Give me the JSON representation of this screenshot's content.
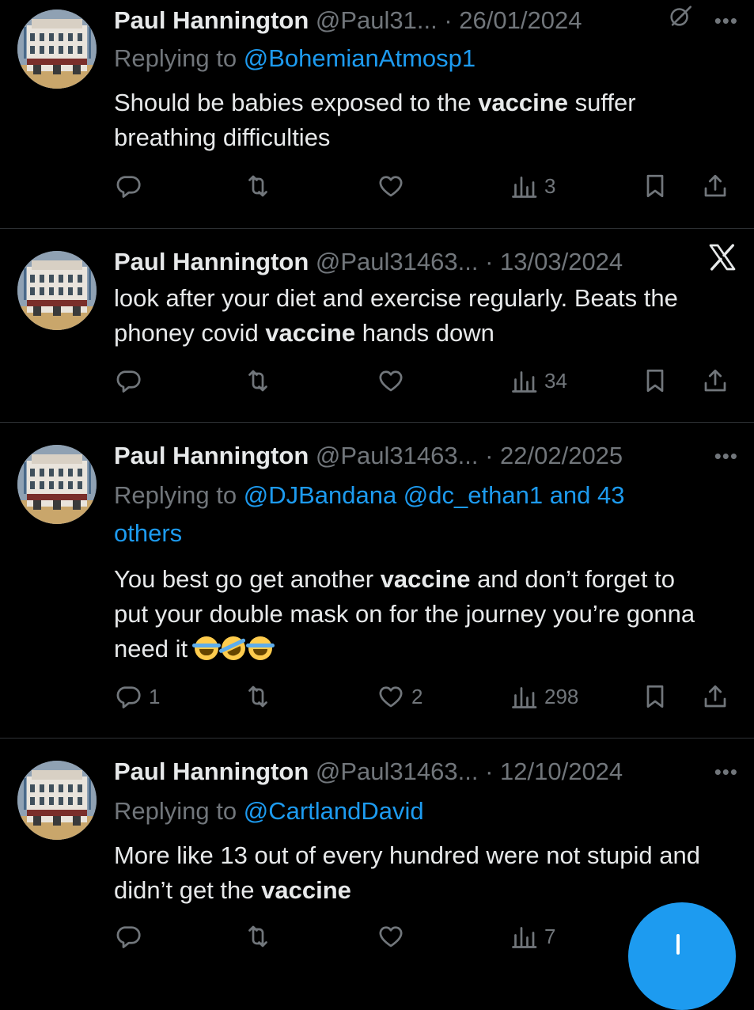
{
  "author": {
    "name": "Paul Hannington"
  },
  "tweets": [
    {
      "handle": "@Paul31...",
      "date": "26/01/2024",
      "reply_prefix": "Replying to",
      "reply_to": "@BohemianAtmosp1",
      "text_parts": [
        "Should be babies exposed to the ",
        "vaccine",
        " suffer breathing difficulties"
      ],
      "metrics": {
        "replies": "",
        "reposts": "",
        "likes": "",
        "views": "3"
      }
    },
    {
      "handle": "@Paul31463...",
      "date": "13/03/2024",
      "text_parts": [
        "look after your diet and exercise regularly. Beats the phoney covid ",
        "vaccine",
        " hands down"
      ],
      "metrics": {
        "replies": "",
        "reposts": "",
        "likes": "",
        "views": "34"
      }
    },
    {
      "handle": "@Paul31463...",
      "date": "22/02/2025",
      "reply_prefix": "Replying to",
      "reply_to": "@DJBandana @dc_ethan1 and 43 others",
      "text_parts": [
        "You best go get another ",
        "vaccine",
        " and don’t forget to put your double mask on for the journey you’re gonna need it "
      ],
      "emojis": [
        "face-with-tears-of-joy",
        "rolling-on-floor-laughing",
        "face-with-tears-of-joy"
      ],
      "metrics": {
        "replies": "1",
        "reposts": "",
        "likes": "2",
        "views": "298"
      }
    },
    {
      "handle": "@Paul31463...",
      "date": "12/10/2024",
      "reply_prefix": "Replying to",
      "reply_to": "@CartlandDavid",
      "text_parts": [
        "More like 13 out of every hundred were not stupid and didn’t get the ",
        "vaccine",
        ""
      ],
      "metrics": {
        "replies": "",
        "reposts": "",
        "likes": "",
        "views": "7"
      }
    }
  ],
  "icons": [
    "reply-icon",
    "repost-icon",
    "like-icon",
    "views-icon",
    "bookmark-icon",
    "share-icon",
    "more-icon",
    "grok-icon",
    "x-logo-icon"
  ],
  "colors": {
    "background": "#000000",
    "text": "#e7e9ea",
    "muted": "#71767b",
    "link": "#1d9bf0",
    "divider": "#2f3336"
  }
}
